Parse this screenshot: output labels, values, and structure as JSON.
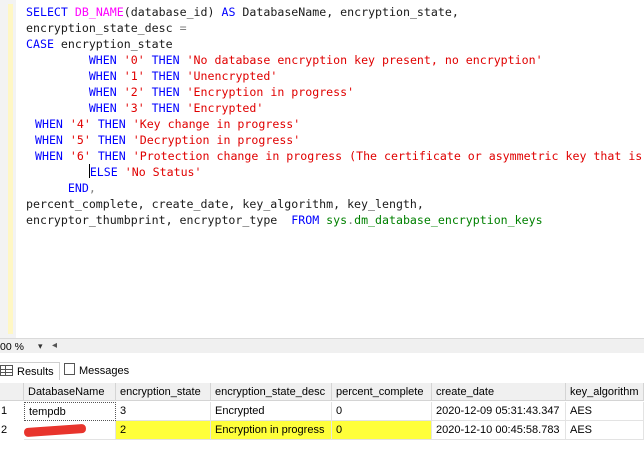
{
  "editor": {
    "code_lines": [
      [
        {
          "t": "SELECT ",
          "c": "kw"
        },
        {
          "t": "DB_NAME",
          "c": "fn"
        },
        {
          "t": "(database_id) ",
          "c": ""
        },
        {
          "t": "AS",
          "c": "kw"
        },
        {
          "t": " DatabaseName, encryption_state,",
          "c": ""
        }
      ],
      [
        {
          "t": "encryption_state_desc ",
          "c": ""
        },
        {
          "t": "=",
          "c": "op"
        }
      ],
      [
        {
          "t": "CASE",
          "c": "kw"
        },
        {
          "t": " encryption_state",
          "c": ""
        }
      ],
      [
        {
          "t": "         ",
          "c": ""
        },
        {
          "t": "WHEN",
          "c": "kw"
        },
        {
          "t": " ",
          "c": ""
        },
        {
          "t": "'0'",
          "c": "str"
        },
        {
          "t": " ",
          "c": ""
        },
        {
          "t": "THEN",
          "c": "kw"
        },
        {
          "t": " ",
          "c": ""
        },
        {
          "t": "'No database encryption key present, no encryption'",
          "c": "str"
        }
      ],
      [
        {
          "t": "         ",
          "c": ""
        },
        {
          "t": "WHEN",
          "c": "kw"
        },
        {
          "t": " ",
          "c": ""
        },
        {
          "t": "'1'",
          "c": "str"
        },
        {
          "t": " ",
          "c": ""
        },
        {
          "t": "THEN",
          "c": "kw"
        },
        {
          "t": " ",
          "c": ""
        },
        {
          "t": "'Unencrypted'",
          "c": "str"
        }
      ],
      [
        {
          "t": "         ",
          "c": ""
        },
        {
          "t": "WHEN",
          "c": "kw"
        },
        {
          "t": " ",
          "c": ""
        },
        {
          "t": "'2'",
          "c": "str"
        },
        {
          "t": " ",
          "c": ""
        },
        {
          "t": "THEN",
          "c": "kw"
        },
        {
          "t": " ",
          "c": ""
        },
        {
          "t": "'Encryption in progress'",
          "c": "str"
        }
      ],
      [
        {
          "t": "         ",
          "c": ""
        },
        {
          "t": "WHEN",
          "c": "kw"
        },
        {
          "t": " ",
          "c": ""
        },
        {
          "t": "'3'",
          "c": "str"
        },
        {
          "t": " ",
          "c": ""
        },
        {
          "t": "THEN",
          "c": "kw"
        },
        {
          "t": " ",
          "c": ""
        },
        {
          "t": "'Encrypted'",
          "c": "str"
        }
      ],
      [
        {
          "t": " ",
          "c": ""
        },
        {
          "t": "WHEN",
          "c": "kw"
        },
        {
          "t": " ",
          "c": ""
        },
        {
          "t": "'4'",
          "c": "str"
        },
        {
          "t": " ",
          "c": ""
        },
        {
          "t": "THEN",
          "c": "kw"
        },
        {
          "t": " ",
          "c": ""
        },
        {
          "t": "'Key change in progress'",
          "c": "str"
        }
      ],
      [
        {
          "t": " ",
          "c": ""
        },
        {
          "t": "WHEN",
          "c": "kw"
        },
        {
          "t": " ",
          "c": ""
        },
        {
          "t": "'5'",
          "c": "str"
        },
        {
          "t": " ",
          "c": ""
        },
        {
          "t": "THEN",
          "c": "kw"
        },
        {
          "t": " ",
          "c": ""
        },
        {
          "t": "'Decryption in progress'",
          "c": "str"
        }
      ],
      [
        {
          "t": " ",
          "c": ""
        },
        {
          "t": "WHEN",
          "c": "kw"
        },
        {
          "t": " ",
          "c": ""
        },
        {
          "t": "'6'",
          "c": "str"
        },
        {
          "t": " ",
          "c": ""
        },
        {
          "t": "THEN",
          "c": "kw"
        },
        {
          "t": " ",
          "c": ""
        },
        {
          "t": "'Protection change in progress (The certificate or asymmetric key that is",
          "c": "str"
        }
      ],
      [
        {
          "t": "         ",
          "c": ""
        },
        {
          "t": "ELSE",
          "c": "kw"
        },
        {
          "t": " ",
          "c": ""
        },
        {
          "t": "'No Status'",
          "c": "str"
        }
      ],
      [
        {
          "t": "      ",
          "c": ""
        },
        {
          "t": "END",
          "c": "kw"
        },
        {
          "t": ",",
          "c": "op"
        }
      ],
      [
        {
          "t": "percent_complete, create_date, key_algorithm, key_length,",
          "c": ""
        }
      ],
      [
        {
          "t": "encryptor_thumbprint, encryptor_type  ",
          "c": ""
        },
        {
          "t": "FROM",
          "c": "kw"
        },
        {
          "t": " ",
          "c": ""
        },
        {
          "t": "sys",
          "c": "sys"
        },
        {
          "t": ".",
          "c": "op"
        },
        {
          "t": "dm_database_encryption_keys",
          "c": "sys"
        }
      ]
    ]
  },
  "statusbar": {
    "zoom": "00 %",
    "zoom_arrow": "▾",
    "scroll_left_arrow": "◂"
  },
  "tabs": {
    "results_label": "Results",
    "messages_label": "Messages"
  },
  "grid": {
    "columns": [
      "DatabaseName",
      "encryption_state",
      "encryption_state_desc",
      "percent_complete",
      "create_date",
      "key_algorithm"
    ],
    "rows": [
      {
        "num": "1",
        "cells": [
          "tempdb",
          "3",
          "Encrypted",
          "0",
          "2020-12-09 05:31:43.347",
          "AES"
        ]
      },
      {
        "num": "2",
        "cells": [
          "",
          "2",
          "Encryption in progress",
          "0",
          "2020-12-10 00:45:58.783",
          "AES"
        ]
      }
    ],
    "highlight_color": "#ffff3b",
    "redaction_color": "#e8342c"
  },
  "colors": {
    "keyword": "#0000ff",
    "function": "#ff00ff",
    "string": "#e00000",
    "system_object": "#008000"
  }
}
